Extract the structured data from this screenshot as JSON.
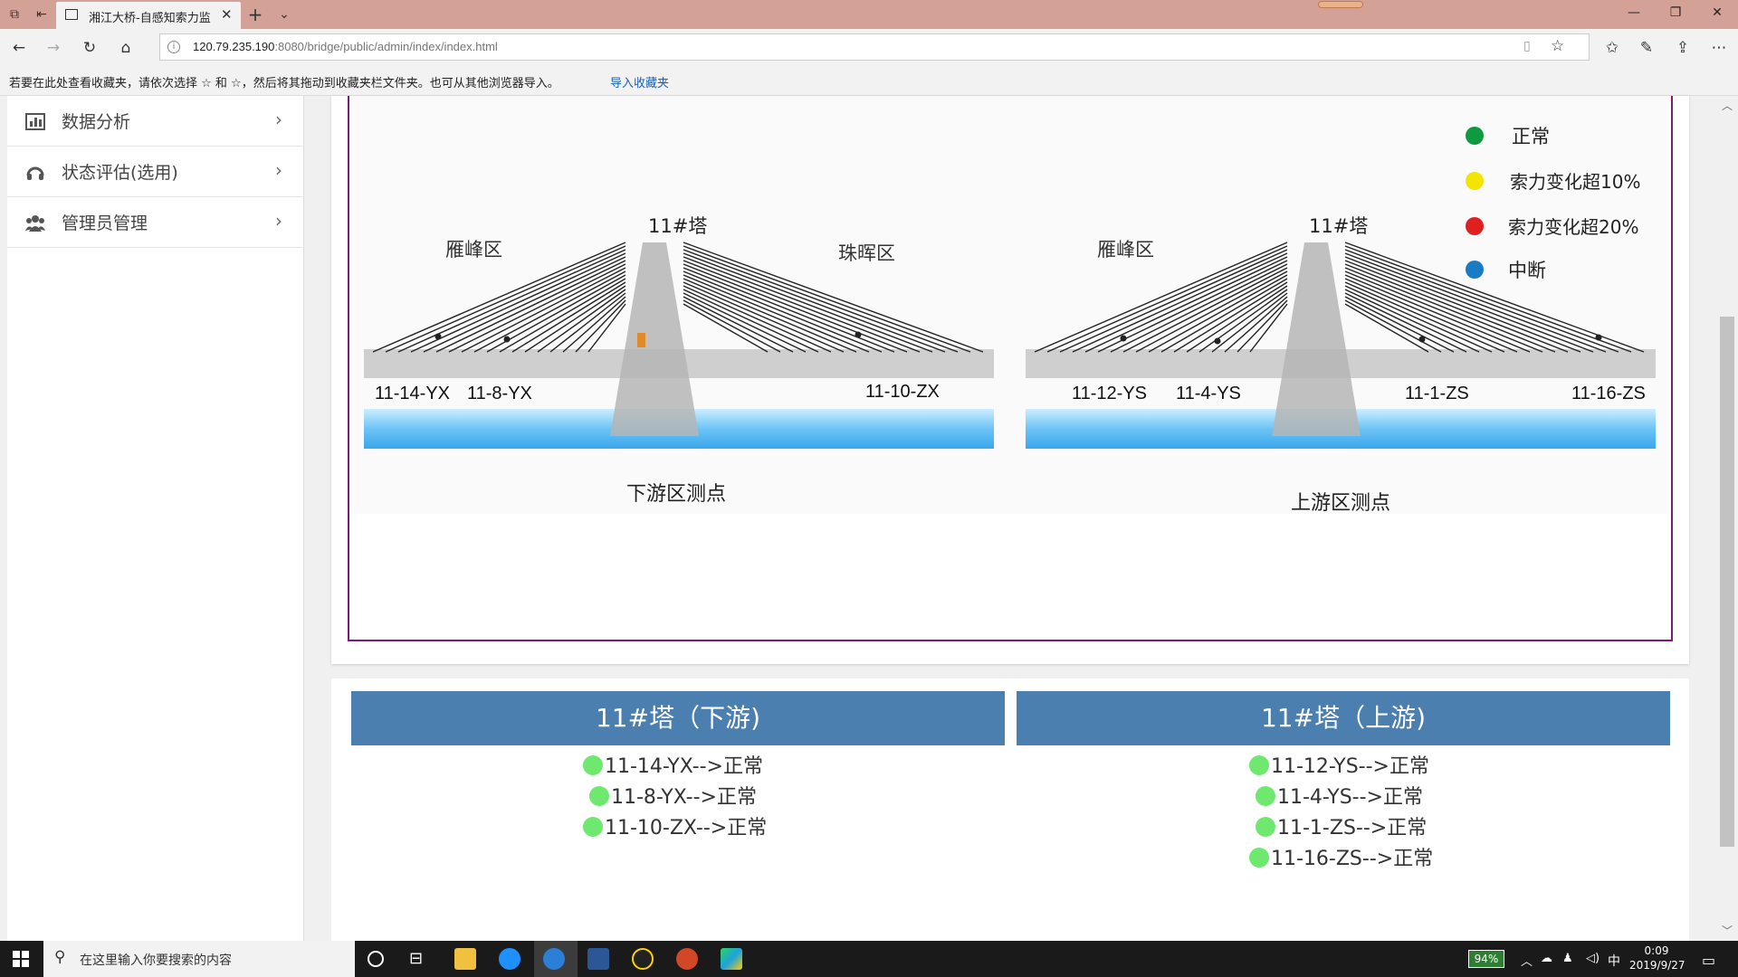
{
  "browser": {
    "tab_title": "湘江大桥-自感知索力监",
    "url_host": "120.79.235.190",
    "url_rest": ":8080/bridge/public/admin/index/index.html",
    "favorites_msg": "若要在此处查看收藏夹，请依次选择 ☆ 和 ☆，然后将其拖动到收藏夹栏文件夹。也可从其他浏览器导入。",
    "favorites_link": "导入收藏夹"
  },
  "sidebar": {
    "items": [
      {
        "label": "数据分析",
        "icon": "bar-chart-icon"
      },
      {
        "label": "状态评估(选用)",
        "icon": "headset-icon"
      },
      {
        "label": "管理员管理",
        "icon": "users-icon"
      }
    ]
  },
  "legend": {
    "items": [
      {
        "label": "正常",
        "color": "#0e9a3e"
      },
      {
        "label": "索力变化超10%",
        "color": "#f5e400"
      },
      {
        "label": "索力变化超20%",
        "color": "#e02020"
      },
      {
        "label": "中断",
        "color": "#1a7ac4"
      }
    ]
  },
  "downstream": {
    "tower": "11#塔",
    "left_zone": "雁峰区",
    "right_zone": "珠晖区",
    "points": [
      "11-14-YX",
      "11-8-YX",
      "11-10-ZX"
    ],
    "caption": "下游区测点"
  },
  "upstream": {
    "tower": "11#塔",
    "left_zone": "雁峰区",
    "points": [
      "11-12-YS",
      "11-4-YS",
      "11-1-ZS",
      "11-16-ZS"
    ],
    "caption": "上游区测点"
  },
  "status": {
    "down_title": "11#塔（下游)",
    "up_title": "11#塔（上游)",
    "down_lines": [
      "11-14-YX-->正常",
      "11-8-YX-->正常",
      "11-10-ZX-->正常"
    ],
    "up_lines": [
      "11-12-YS-->正常",
      "11-4-YS-->正常",
      "11-1-ZS-->正常",
      "11-16-ZS-->正常"
    ],
    "ok_color": "#6ee86e"
  },
  "taskbar": {
    "search_placeholder": "在这里输入你要搜索的内容",
    "battery": "94%",
    "ime": "中",
    "time": "0:09",
    "date": "2019/9/27"
  }
}
